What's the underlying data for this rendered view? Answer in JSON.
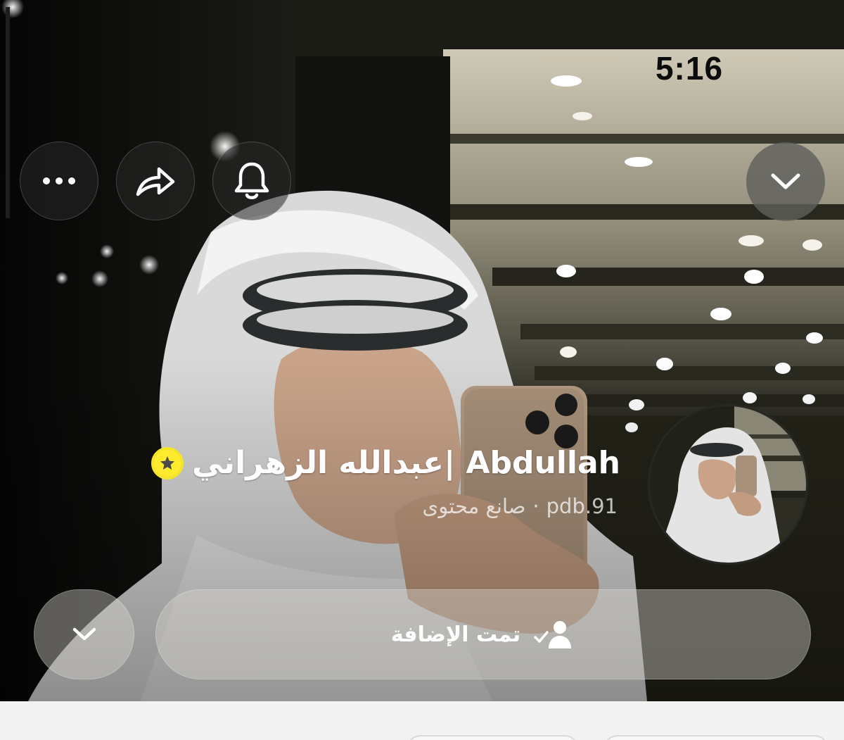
{
  "status_bar": {
    "time": "5:16"
  },
  "actions": {
    "more_icon": "ellipsis-icon",
    "share_icon": "share-arrow-icon",
    "notify_icon": "bell-icon",
    "collapse_icon": "chevron-down-icon"
  },
  "profile": {
    "display_name": "عبدالله الزهراني| Abdullah",
    "badge_icon": "star-badge-icon",
    "badge_color": "#f5e52a",
    "username": "pdb.91",
    "separator": "·",
    "category": "صانع محتوى"
  },
  "buttons": {
    "added_label": "تمت الإضافة",
    "added_icon": "person-check-icon",
    "more_options_icon": "chevron-down-icon"
  },
  "colors": {
    "pill_background": "#d7d4cd",
    "sheet_background": "#f3f3f3"
  }
}
